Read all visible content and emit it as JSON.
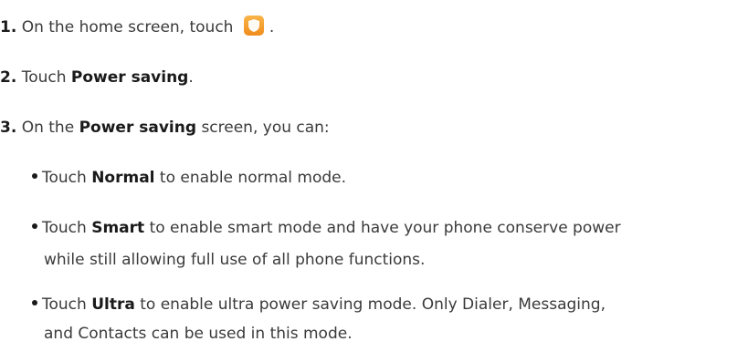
{
  "steps": [
    {
      "num": "1.",
      "pre": "On the home screen, touch",
      "icon": "phone-manager-shield-icon",
      "post": "."
    },
    {
      "num": "2.",
      "pre": "Touch",
      "bold": "Power saving",
      "post": "."
    },
    {
      "num": "3.",
      "pre": "On the",
      "bold": "Power saving",
      "post": "screen, you can:"
    }
  ],
  "bullets": [
    {
      "pre": "Touch",
      "bold": "Normal",
      "post": "to enable normal mode.",
      "cont": ""
    },
    {
      "pre": "Touch",
      "bold": "Smart",
      "post": "to enable smart mode and have your phone conserve power",
      "cont": "while still allowing full use of all phone functions."
    },
    {
      "pre": "Touch",
      "bold": "Ultra",
      "post": "to enable ultra power saving mode. Only Dialer, Messaging,",
      "cont": "and Contacts can be used in this mode."
    }
  ],
  "colors": {
    "text": "#3a3a3a",
    "bold_text": "#1a1a1a",
    "icon_gradient_top": "#f9b54a",
    "icon_gradient_bottom": "#f08c1c"
  }
}
